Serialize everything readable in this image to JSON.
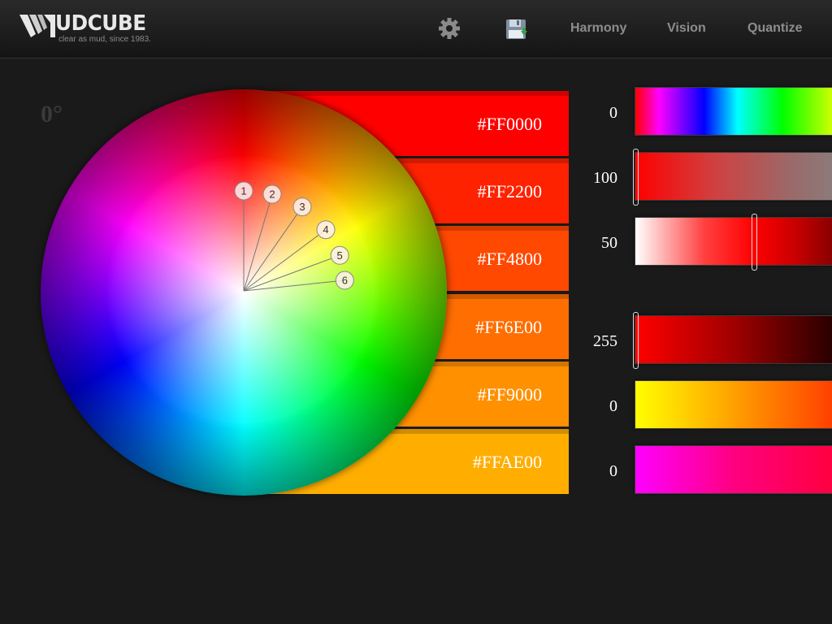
{
  "header": {
    "logo_text": "UDCUBE",
    "logo_tagline": "clear as mud, since 1983.",
    "nav": {
      "settings_icon": "gear-icon",
      "save_icon": "save-icon",
      "harmony": "Harmony",
      "vision": "Vision",
      "quantize": "Quantize"
    }
  },
  "wheel": {
    "angle_label": "0°",
    "markers": [
      {
        "label": "1",
        "hue_deg": 0
      },
      {
        "label": "2",
        "hue_deg": 8
      },
      {
        "label": "3",
        "hue_deg": 17
      },
      {
        "label": "4",
        "hue_deg": 26
      },
      {
        "label": "5",
        "hue_deg": 34
      },
      {
        "label": "6",
        "hue_deg": 41
      }
    ]
  },
  "swatches": [
    {
      "hex": "#FF0000",
      "color": "#FF0000"
    },
    {
      "hex": "#FF2200",
      "color": "#FF2200"
    },
    {
      "hex": "#FF4800",
      "color": "#FF4800"
    },
    {
      "hex": "#FF6E00",
      "color": "#FF6E00"
    },
    {
      "hex": "#FF9000",
      "color": "#FF9000"
    },
    {
      "hex": "#FFAE00",
      "color": "#FFAE00"
    }
  ],
  "sliders": {
    "hue": {
      "value": "0",
      "fraction": 0
    },
    "saturation": {
      "value": "100",
      "fraction": 0
    },
    "lightness": {
      "value": "50",
      "fraction": 0.62
    },
    "red": {
      "value": "255",
      "fraction": 0
    },
    "green": {
      "value": "0",
      "fraction": null
    },
    "blue": {
      "value": "0",
      "fraction": null
    }
  }
}
